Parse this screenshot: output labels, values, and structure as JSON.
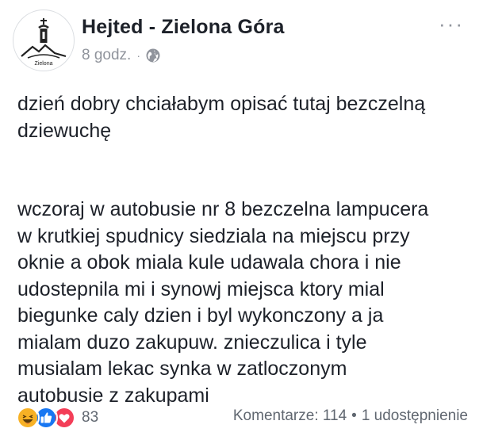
{
  "header": {
    "page_name": "Hejted - Zielona Góra",
    "time": "8 godz.",
    "separator": "·",
    "privacy_icon": "globe-icon",
    "more_icon": "ellipsis-icon",
    "more_label": "···",
    "avatar_caption": "Zielona"
  },
  "post": {
    "paragraphs": [
      "dzień dobry chciałabym opisać tutaj bezczelną\ndziewuchę",
      "wczoraj w autobusie nr 8 bezczelna lampucera\nw krutkiej spudnicy siedziala na miejscu przy\noknie a obok miala kule udawala chora i nie\nudostepnila mi i synowj miejsca ktory mial\nbiegunke caly dzien i byl wykonczony a ja\nmialam duzo zakupuw. znieczulica i tyle\nmusialam lekac synka w zatloczonym\nautobusie z zakupami"
    ]
  },
  "footer": {
    "reactions": [
      "haha-icon",
      "like-icon",
      "love-icon"
    ],
    "reaction_count": "83",
    "comments": "Komentarze: 114",
    "separator": "•",
    "shares": "1 udostępnienie"
  },
  "colors": {
    "text": "#1d2129",
    "muted": "#90949c",
    "like_blue": "#1877f2",
    "love_red": "#f33e58",
    "haha_yellow": "#f7b125"
  }
}
